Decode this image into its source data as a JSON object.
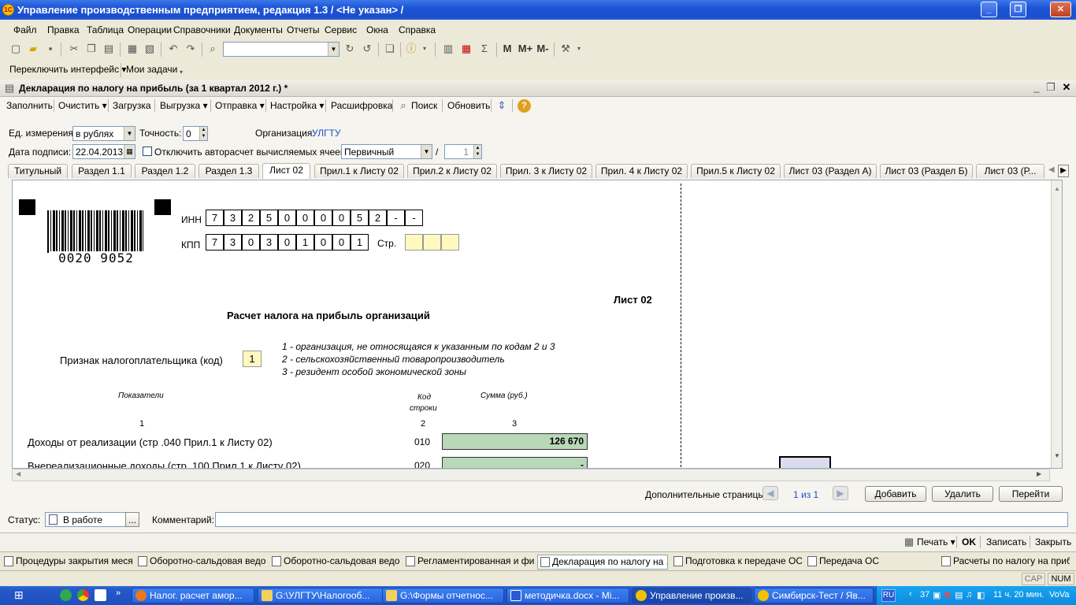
{
  "app_title": "Управление производственным предприятием, редакция 1.3 / <Не указан> /",
  "logo_text": "1С",
  "window_buttons": {
    "minimize": "_",
    "restore": "❐",
    "close": "✕"
  },
  "menu": [
    "Файл",
    "Правка",
    "Таблица",
    "Операции",
    "Справочники",
    "Документы",
    "Отчеты",
    "Сервис",
    "Окна",
    "Справка"
  ],
  "toolbar_mplus": {
    "m": "M",
    "mplus": "M+",
    "mminus": "M-"
  },
  "toolbar2": {
    "switch_interface": "Переключить интерфейс ▾",
    "my_tasks": "Мои задачи"
  },
  "document": {
    "title": "Декларация по налогу на прибыль (за 1 квартал 2012 г.) *",
    "commands": [
      "Заполнить",
      "Очистить ▾",
      "Загрузка",
      "Выгрузка ▾",
      "Отправка ▾",
      "Настройка ▾",
      "Расшифровка",
      "Поиск",
      "Обновить"
    ],
    "unit_label": "Ед. измерения:",
    "unit_value": "в рублях",
    "precision_label": "Точность:",
    "precision_value": "0",
    "org_label": "Организация:",
    "org_value": "УЛГТУ",
    "sign_date_label": "Дата подписи:",
    "sign_date_value": "22.04.2013",
    "autocalc_label": "Отключить авторасчет вычисляемых ячеек",
    "doc_kind_value": "Первичный",
    "slash": "/",
    "correction_value": "1"
  },
  "tabs": [
    "Титульный",
    "Раздел 1.1",
    "Раздел 1.2",
    "Раздел 1.3",
    "Лист 02",
    "Прил.1 к Листу 02",
    "Прил.2 к Листу 02",
    "Прил. 3 к Листу 02",
    "Прил. 4 к Листу 02",
    "Прил.5 к Листу 02",
    "Лист 03 (Раздел А)",
    "Лист 03 (Раздел Б)",
    "Лист 03 (Р..."
  ],
  "form": {
    "barcode_number": "0020 9052",
    "inn_label": "ИНН",
    "inn_digits": [
      "7",
      "3",
      "2",
      "5",
      "0",
      "0",
      "0",
      "0",
      "5",
      "2",
      "-",
      "-"
    ],
    "kpp_label": "КПП",
    "kpp_digits": [
      "7",
      "3",
      "0",
      "3",
      "0",
      "1",
      "0",
      "0",
      "1"
    ],
    "page_label": "Стр.",
    "sheet_label": "Лист 02",
    "heading": "Расчет налога на прибыль организаций",
    "taxpayer_label": "Признак налогоплательщика (код)",
    "taxpayer_code": "1",
    "taxpayer_options": [
      "1 - организация, не относящаяся к указанным по кодам 2 и 3",
      "2 - сельскохозяйственный товаропроизводитель",
      "3 - резидент особой экономической зоны"
    ],
    "col_indicators": "Показатели",
    "col_code_1": "Код",
    "col_code_2": "строки",
    "col_sum": "Сумма (руб.)",
    "col_num_1": "1",
    "col_num_2": "2",
    "col_num_3": "3",
    "rows": [
      {
        "label": "Доходы от реализации (стр .040 Прил.1 к Листу 02)",
        "code": "010",
        "value": "126 670"
      },
      {
        "label": "Внереализационные доходы (стр .100 Прил.1 к Листу 02)",
        "code": "020",
        "value": "-"
      }
    ]
  },
  "extra_pages": {
    "label": "Дополнительные страницы:",
    "counter": "1 из 1",
    "add": "Добавить",
    "delete": "Удалить",
    "goto": "Перейти"
  },
  "status": {
    "label": "Статус:",
    "value": "В работе",
    "comment_label": "Комментарий:",
    "more": "..."
  },
  "bottom_buttons": {
    "print": "Печать ▾",
    "ok": "OK",
    "save": "Записать",
    "close": "Закрыть"
  },
  "window_tabs": [
    "Процедуры закрытия меся...",
    "Оборотно-сальдовая ведо...",
    "Оборотно-сальдовая ведо...",
    "Регламентированная и фи...",
    "Декларация по налогу на ...",
    "Подготовка к передаче ОС",
    "Передача ОС",
    "Расчеты по налогу на приб..."
  ],
  "statusbar": {
    "cap": "CAP",
    "num": "NUM"
  },
  "taskbar": {
    "items": [
      "Налог. расчет амор...",
      "G:\\УЛГТУ\\Налогооб...",
      "G:\\Формы отчетнос...",
      "методичка.docx - Mi...",
      "Управление произв...",
      "Симбирск-Тест / Яв..."
    ],
    "lang": "RU",
    "clock": "11 ч. 20 мин.",
    "user": "VoVa",
    "tray_count": "37"
  },
  "colors": {
    "title_blue": "#1d54d6",
    "green_field": "#b8d8b8",
    "yellow_cell": "#fff9c0",
    "org_link": "#1a4fcf"
  }
}
